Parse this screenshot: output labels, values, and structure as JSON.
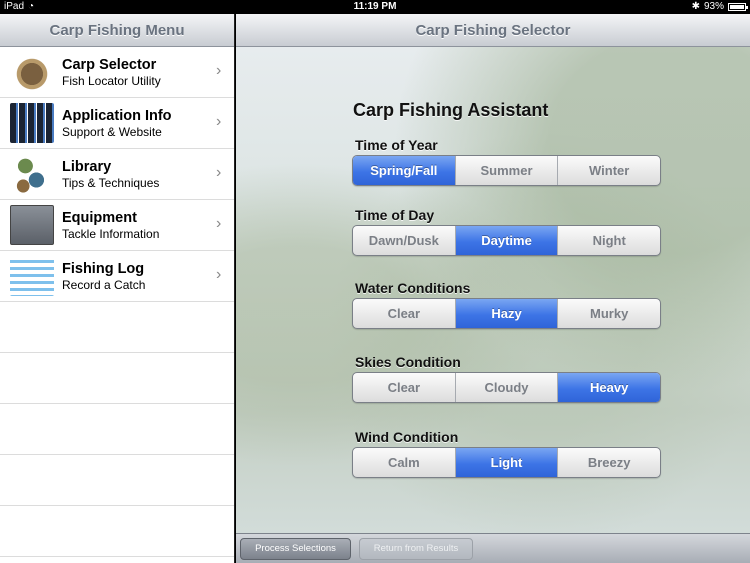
{
  "status_bar": {
    "carrier": "iPad",
    "time": "11:19 PM",
    "battery_pct": "93%",
    "battery_level": 0.93
  },
  "master": {
    "title": "Carp Fishing Menu",
    "items": [
      {
        "title": "Carp Selector",
        "subtitle": "Fish Locator Utility",
        "icon": "carp-fish-icon"
      },
      {
        "title": "Application Info",
        "subtitle": "Support & Website",
        "icon": "app-screens-icon"
      },
      {
        "title": "Library",
        "subtitle": "Tips & Techniques",
        "icon": "fish-tips-icon"
      },
      {
        "title": "Equipment",
        "subtitle": "Tackle Information",
        "icon": "tackle-box-icon"
      },
      {
        "title": "Fishing Log",
        "subtitle": "Record a Catch",
        "icon": "log-sheet-icon"
      }
    ]
  },
  "detail": {
    "title": "Carp Fishing Selector",
    "heading": "Carp Fishing Assistant",
    "groups": [
      {
        "label": "Time of Year",
        "options": [
          "Spring/Fall",
          "Summer",
          "Winter"
        ],
        "selected": "Spring/Fall"
      },
      {
        "label": "Time of Day",
        "options": [
          "Dawn/Dusk",
          "Daytime",
          "Night"
        ],
        "selected": "Daytime"
      },
      {
        "label": "Water Conditions",
        "options": [
          "Clear",
          "Hazy",
          "Murky"
        ],
        "selected": "Hazy"
      },
      {
        "label": "Skies Condition",
        "options": [
          "Clear",
          "Cloudy",
          "Heavy"
        ],
        "selected": "Heavy"
      },
      {
        "label": "Wind Condition",
        "options": [
          "Calm",
          "Light",
          "Breezy"
        ],
        "selected": "Light"
      }
    ],
    "toolbar": {
      "process_label": "Process Selections",
      "return_label": "Return from Results"
    }
  },
  "colors": {
    "selected_segment": "#3d74e6",
    "nav_title": "#6a7380"
  }
}
